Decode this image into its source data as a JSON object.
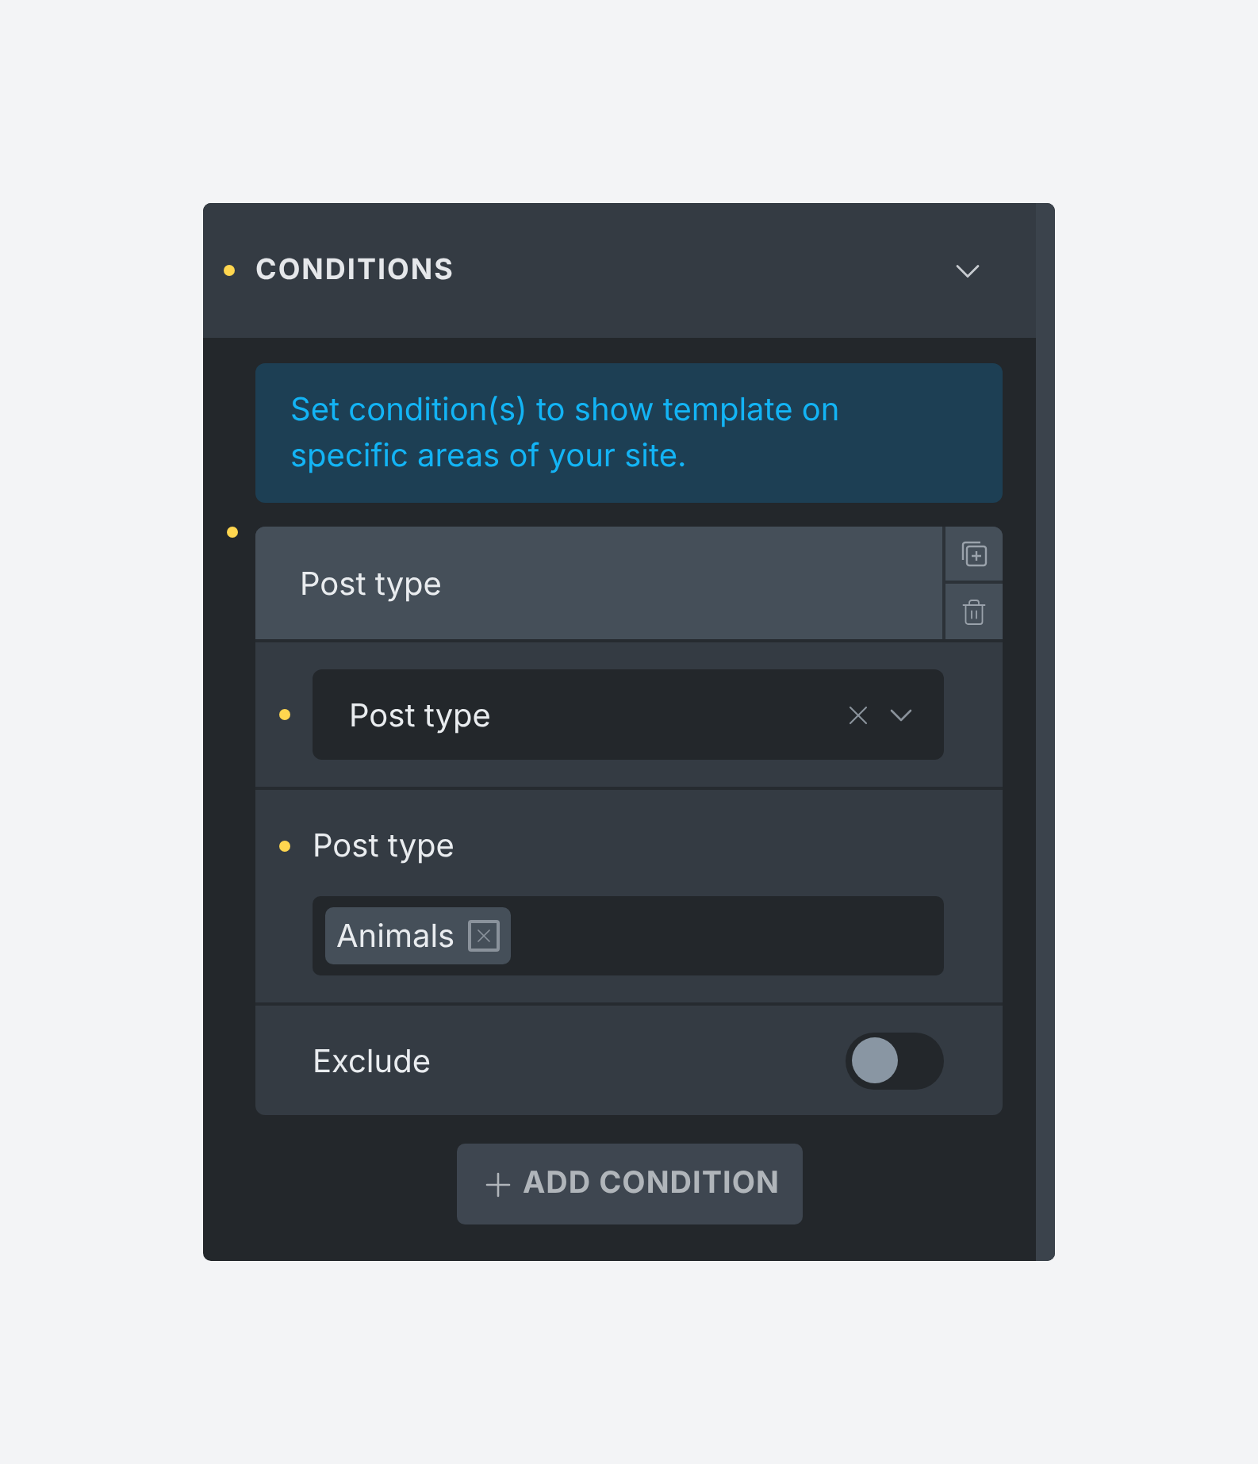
{
  "panel": {
    "title": "CONDITIONS",
    "changed": true
  },
  "notice": "Set condition(s) to show template on specific areas of your site.",
  "condition": {
    "title": "Post type",
    "changed": true,
    "select": {
      "value": "Post type",
      "changed": true
    },
    "field": {
      "label": "Post type",
      "changed": true,
      "tags": [
        "Animals"
      ]
    },
    "exclude": {
      "label": "Exclude",
      "changed": false,
      "on": false
    }
  },
  "add_button": "ADD CONDITION"
}
